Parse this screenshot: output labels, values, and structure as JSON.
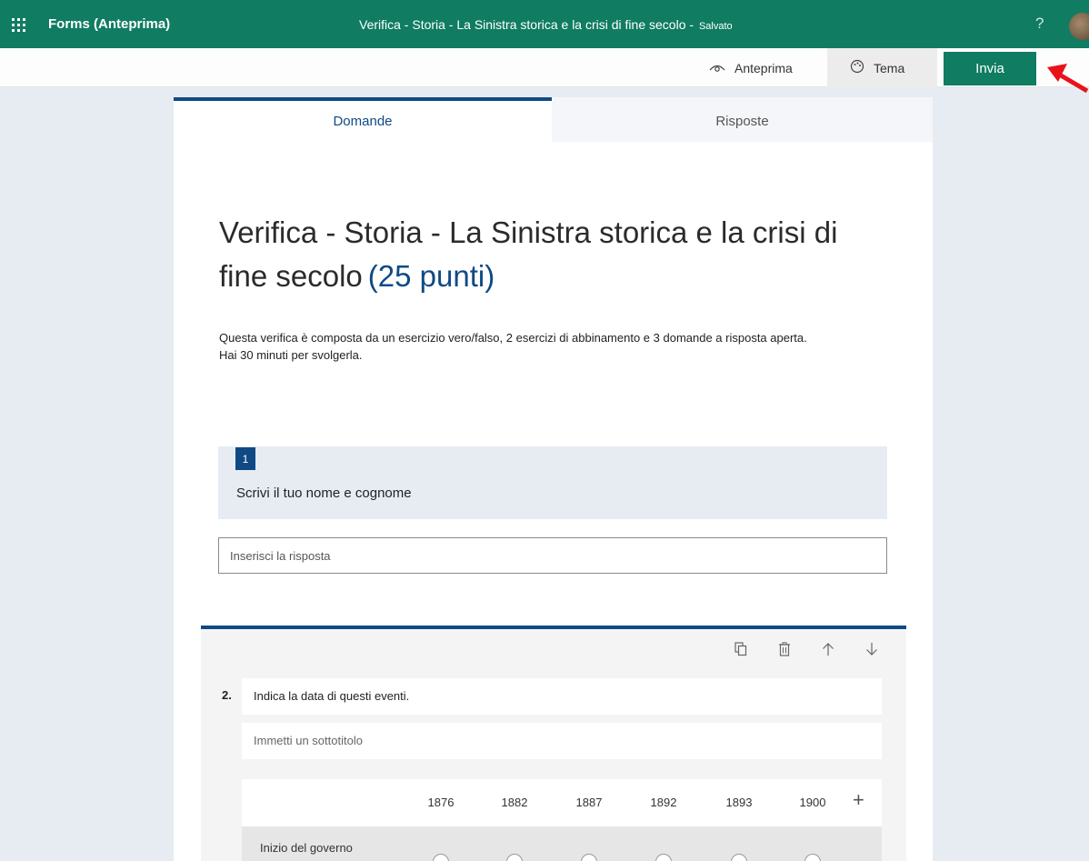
{
  "topbar": {
    "app_name": "Forms (Anteprima)",
    "doc_title": "Verifica - Storia - La Sinistra storica e la crisi di fine secolo",
    "title_separator": "-",
    "saved_status": "Salvato",
    "help": "?"
  },
  "toolbar": {
    "preview_label": "Anteprima",
    "theme_label": "Tema",
    "send_label": "Invia"
  },
  "tabs": [
    {
      "label": "Domande",
      "active": true
    },
    {
      "label": "Risposte",
      "active": false
    }
  ],
  "form": {
    "title": "Verifica - Storia - La Sinistra storica e la crisi di fine secolo",
    "points": "(25 punti)",
    "description_line1": "Questa verifica è composta da un esercizio vero/falso, 2 esercizi di abbinamento e 3 domande a risposta aperta.",
    "description_line2": "Hai 30 minuti per svolgerla."
  },
  "question1": {
    "number": "1",
    "text": "Scrivi il tuo nome e cognome",
    "answer_placeholder": "Inserisci la risposta"
  },
  "question2": {
    "number": "2.",
    "text": "Indica la data di questi eventi.",
    "subtitle_placeholder": "Immetti un sottotitolo",
    "columns": [
      "1876",
      "1882",
      "1887",
      "1892",
      "1893",
      "1900"
    ],
    "rows": [
      "Inizio del governo"
    ],
    "add_column": "+"
  },
  "colors": {
    "brand": "#107c62",
    "accent": "#0f4a85",
    "arrow": "#e8131a"
  }
}
